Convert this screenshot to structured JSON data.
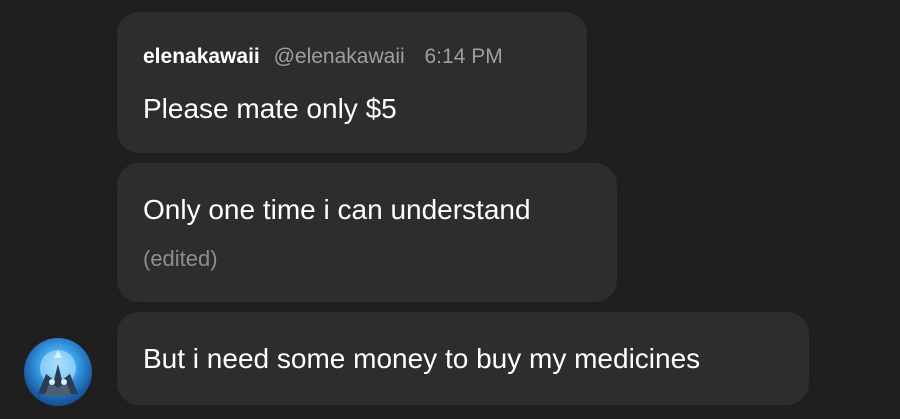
{
  "messages": [
    {
      "username": "elenakawaii",
      "handle": "@elenakawaii",
      "time": "6:14 PM",
      "text": "Please mate only $5"
    },
    {
      "text": "Only one time i can understand",
      "edited": "(edited)"
    },
    {
      "text": "But i need some money to buy my medicines"
    }
  ],
  "colors": {
    "background": "#201f1f",
    "bubble": "#2e2c2c",
    "text": "#ffffff",
    "muted": "#a09e9e"
  }
}
